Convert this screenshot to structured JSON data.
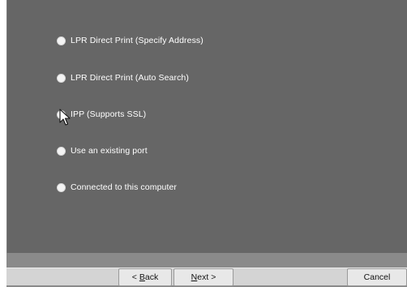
{
  "options": [
    {
      "label": "LPR Direct Print (Specify Address)",
      "checked": false
    },
    {
      "label": "LPR Direct Print (Auto Search)",
      "checked": false
    },
    {
      "label": "IPP (Supports SSL)",
      "checked": true
    },
    {
      "label": "Use an existing port",
      "checked": false
    },
    {
      "label": "Connected to this computer",
      "checked": false
    }
  ],
  "buttons": {
    "back": {
      "prefix": "< ",
      "accel": "B",
      "rest": "ack"
    },
    "next": {
      "prefix": "",
      "accel": "N",
      "rest": "ext >"
    },
    "cancel": {
      "label": "Cancel"
    }
  },
  "icons": {
    "cursor": "mouse-pointer-icon"
  },
  "colors": {
    "panel": "#666666",
    "footer": "#d4d4d4",
    "button": "#e8e8e8",
    "option_text": "#ffffff"
  }
}
